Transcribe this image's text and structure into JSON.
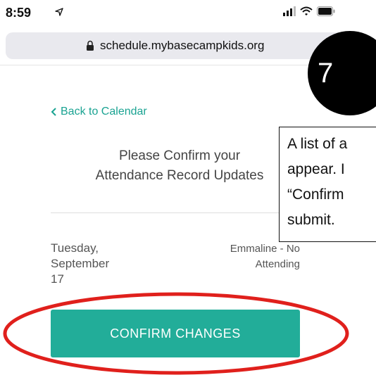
{
  "status_bar": {
    "time": "8:59"
  },
  "browser": {
    "url": "schedule.mybasecampkids.org"
  },
  "nav": {
    "back_label": "Back to Calendar"
  },
  "page": {
    "title_line1": "Please Confirm your",
    "title_line2": "Attendance Record Updates"
  },
  "record": {
    "date_line1": "Tuesday,",
    "date_line2": "September",
    "date_line3": "17",
    "status_line1": "Emmaline - No",
    "status_line2": "Attending"
  },
  "actions": {
    "confirm_label": "CONFIRM CHANGES"
  },
  "annotation": {
    "step_number": "7",
    "callout_line1": "A list of a",
    "callout_line2": "appear. I",
    "callout_line3": "“Confirm",
    "callout_line4": "submit."
  },
  "colors": {
    "accent": "#22ad99",
    "link": "#1aa392",
    "highlight": "#e0201c"
  }
}
